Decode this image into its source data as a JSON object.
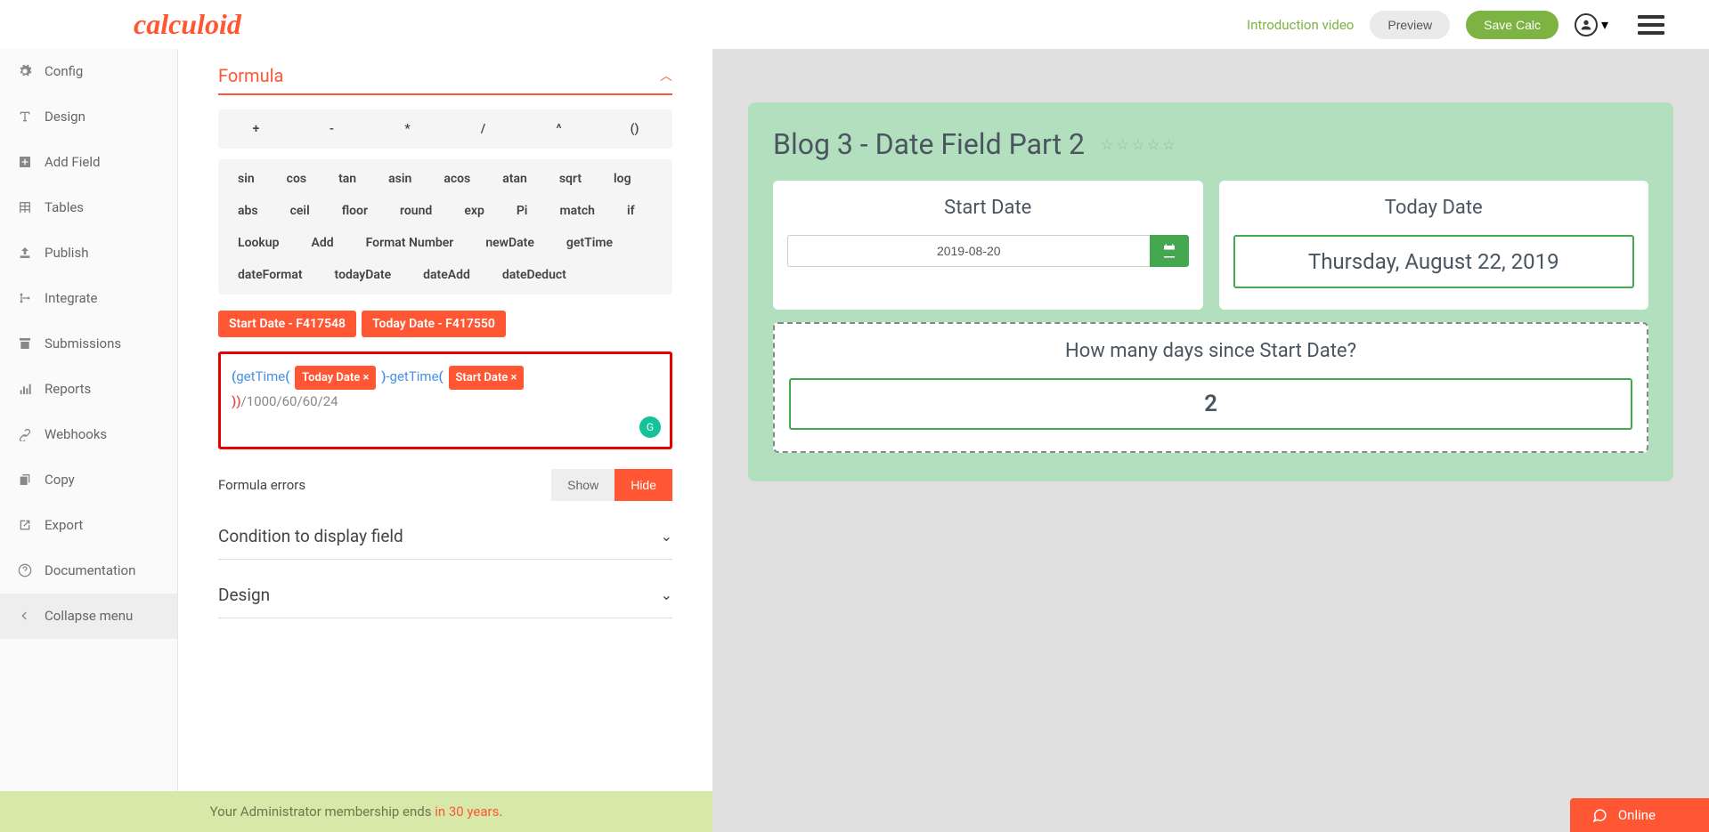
{
  "header": {
    "logo": "calculoid",
    "intro_link": "Introduction video",
    "preview": "Preview",
    "save": "Save Calc"
  },
  "sidebar": {
    "items": [
      {
        "label": "Config",
        "icon": "gear"
      },
      {
        "label": "Design",
        "icon": "text"
      },
      {
        "label": "Add Field",
        "icon": "plus-box"
      },
      {
        "label": "Tables",
        "icon": "table"
      },
      {
        "label": "Publish",
        "icon": "upload"
      },
      {
        "label": "Integrate",
        "icon": "branch"
      },
      {
        "label": "Submissions",
        "icon": "archive"
      },
      {
        "label": "Reports",
        "icon": "bars"
      },
      {
        "label": "Webhooks",
        "icon": "link"
      },
      {
        "label": "Copy",
        "icon": "copy"
      },
      {
        "label": "Export",
        "icon": "export"
      },
      {
        "label": "Documentation",
        "icon": "help"
      },
      {
        "label": "Collapse menu",
        "icon": "collapse"
      }
    ]
  },
  "formula": {
    "title": "Formula",
    "operators": [
      "+",
      "-",
      "*",
      "/",
      "^",
      "()"
    ],
    "functions": [
      "sin",
      "cos",
      "tan",
      "asin",
      "acos",
      "atan",
      "sqrt",
      "log",
      "abs",
      "ceil",
      "floor",
      "round",
      "exp",
      "Pi",
      "match",
      "if",
      "Lookup",
      "Add",
      "Format Number",
      "newDate",
      "getTime",
      "dateFormat",
      "todayDate",
      "dateAdd",
      "dateDeduct"
    ],
    "field_tags": [
      "Start Date - F417548",
      "Today Date - F417550"
    ],
    "expr": {
      "p1": "(",
      "fn1": "getTime",
      "op1": "(",
      "tag1": "Today Date",
      "x1": "×",
      "cp1": ")",
      "minus": "-",
      "fn2": "getTime",
      "op2": "(",
      "tag2": "Start Date",
      "x2": "×",
      "cp2": ")",
      "cp3": ")",
      "rest": "/1000/60/60/24"
    },
    "errors_label": "Formula errors",
    "show": "Show",
    "hide": "Hide",
    "condition": "Condition to display field",
    "design": "Design"
  },
  "calc": {
    "title": "Blog 3 - Date Field Part 2",
    "start_label": "Start Date",
    "start_value": "2019-08-20",
    "today_label": "Today Date",
    "today_value": "Thursday, August 22, 2019",
    "result_label": "How many days since Start Date?",
    "result_value": "2"
  },
  "footer": {
    "text": "Your Administrator membership ends ",
    "accent": "in 30 years",
    "dot": "."
  },
  "online": "Online"
}
